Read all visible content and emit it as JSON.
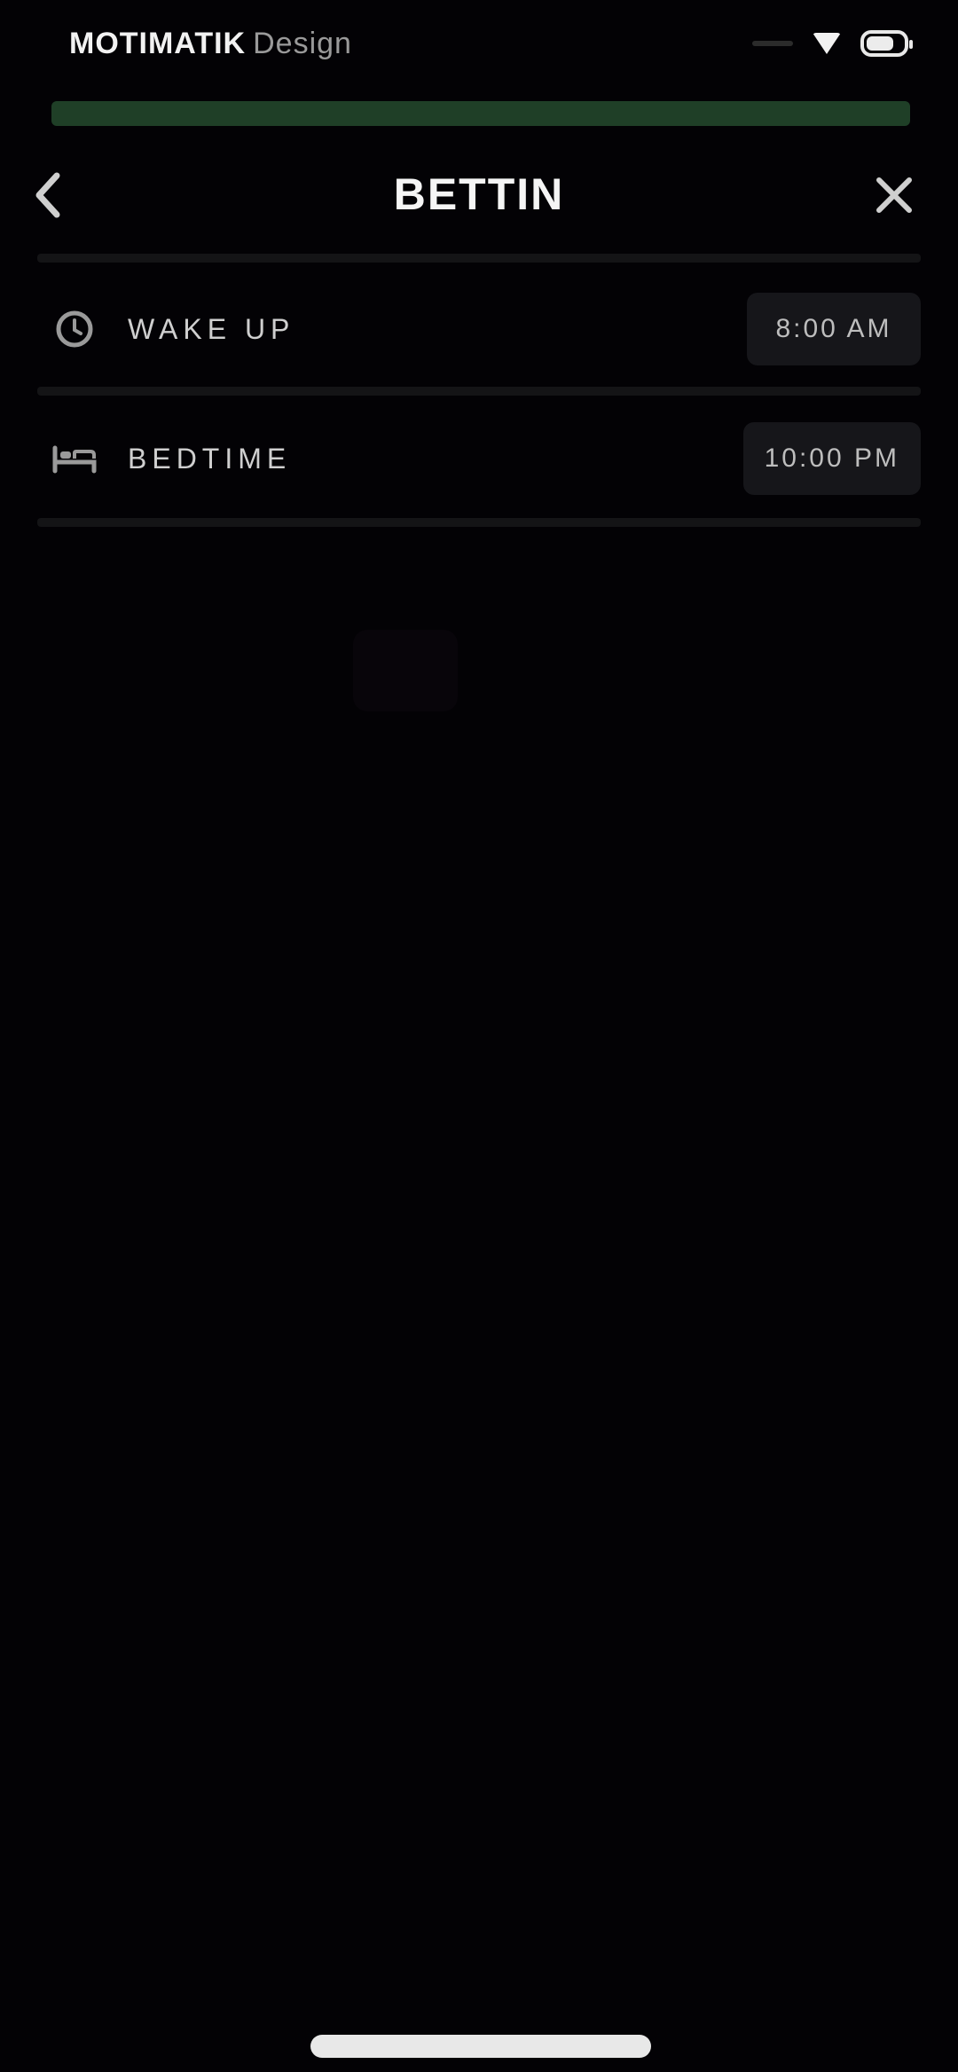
{
  "status_bar": {
    "carrier": "MOTIMATIK",
    "carrier_suffix": "Design",
    "signal_icon": "signal-icon",
    "wifi_icon": "wifi-icon",
    "battery_icon": "battery-icon"
  },
  "progress": {
    "fraction": 1.0,
    "color": "#1f3f27"
  },
  "nav": {
    "title": "BETTIN",
    "back_icon": "chevron-left-icon",
    "close_icon": "close-icon"
  },
  "rows": [
    {
      "icon": "clock-icon",
      "label": "WAKE UP",
      "value": "8:00 AM"
    },
    {
      "icon": "bed-icon",
      "label": "BEDTIME",
      "value": "10:00 PM"
    }
  ],
  "colors": {
    "background": "#030205",
    "accent": "#1f3f27"
  }
}
